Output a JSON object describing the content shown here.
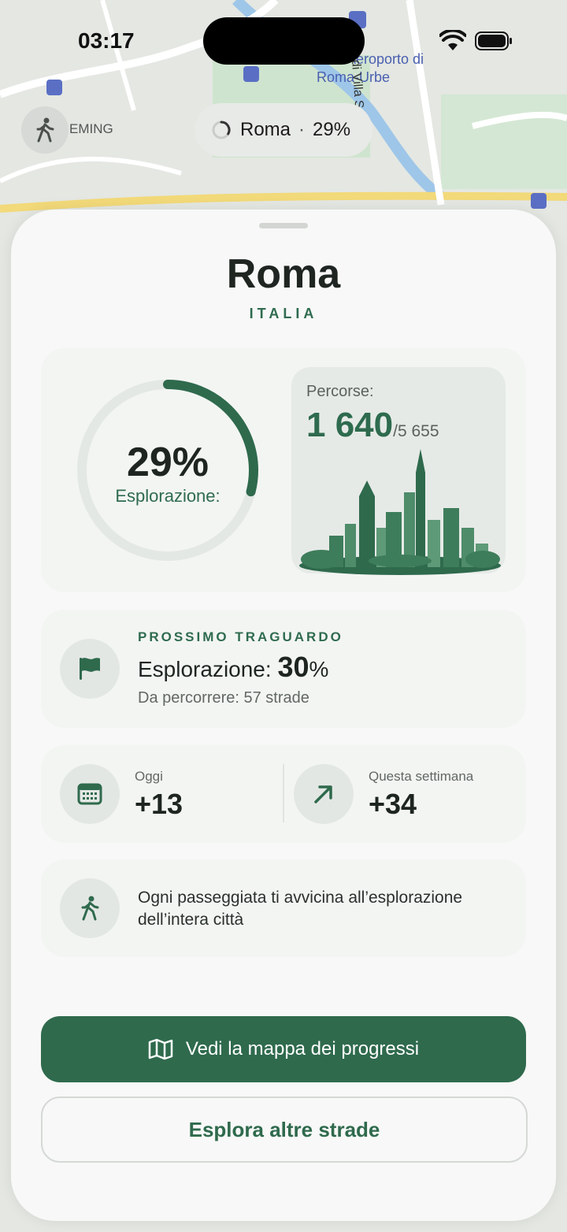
{
  "status_bar": {
    "time": "03:17"
  },
  "map": {
    "labels": {
      "airport": "Aeroporto di",
      "airport2": "Roma-Urbe",
      "street": "Via di Villa Spada",
      "district": "EMING"
    }
  },
  "city_pill": {
    "city": "Roma",
    "separator": "·",
    "percent": "29%"
  },
  "sheet": {
    "city": "Roma",
    "country": "ITALIA",
    "progress": {
      "percent_label": "29%",
      "fraction": 0.29,
      "label": "Esplorazione:",
      "streets_label": "Percorse:",
      "streets_done": "1 640",
      "streets_total": "/5 655"
    },
    "milestone": {
      "overline": "PROSSIMO TRAGUARDO",
      "title": "Esplorazione: ",
      "value": "30",
      "unit": "%",
      "subtitle": "Da percorrere: 57 strade"
    },
    "stats": {
      "today_label": "Oggi",
      "today_value": "+13",
      "week_label": "Questa settimana",
      "week_value": "+34"
    },
    "tip": "Ogni passeggiata ti avvicina all’esplorazione dell’intera città",
    "primary_button": "Vedi la mappa dei progressi",
    "secondary_button": "Esplora altre strade"
  },
  "colors": {
    "accent": "#2f6a4d",
    "accent_light": "#e3e7e4"
  }
}
